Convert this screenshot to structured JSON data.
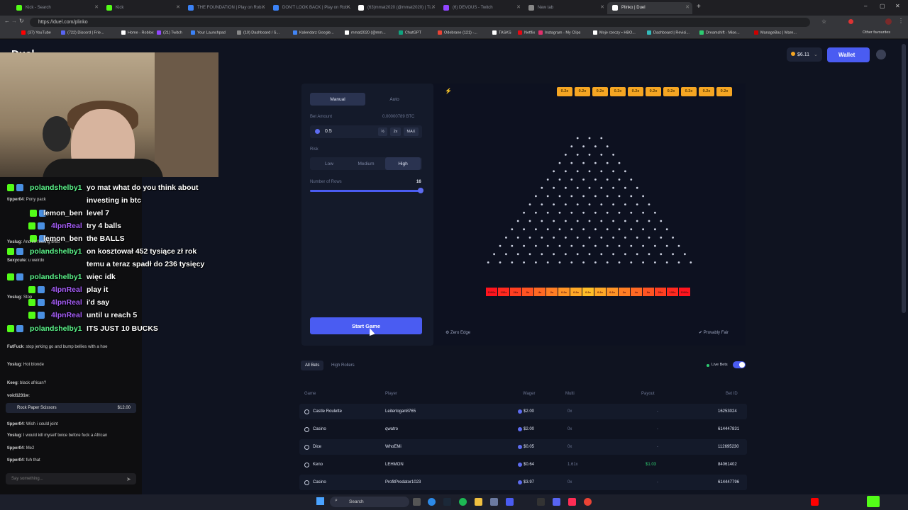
{
  "browser": {
    "tabs": [
      {
        "label": "Kick - Search",
        "color": "#53fc18"
      },
      {
        "label": "Kick",
        "color": "#53fc18"
      },
      {
        "label": "THE FOUNDATION | Play on Rob...",
        "color": "#3b82f6"
      },
      {
        "label": "DON'T LOOK BACK | Play on Rob...",
        "color": "#3b82f6"
      },
      {
        "label": "(63)mmat2020 (@mmat2020) | Ti...",
        "color": "#ffffff"
      },
      {
        "label": "(6) DEVOUS - Twitch",
        "color": "#9146ff"
      },
      {
        "label": "New tab",
        "color": "#888888"
      },
      {
        "label": "Plinko | Duel",
        "color": "#ffffff"
      }
    ],
    "url": "https://duel.com/plinko",
    "bookmarks": [
      "(37) YouTube",
      "(722) Discord | Frie...",
      "Home - Roblox",
      "(21) Twitch",
      "Your Launchpad",
      "(10) Dashboard / S...",
      "Kalendarz Google...",
      "mmat2020 (@mm...",
      "ChatGPT",
      "Odebrane (121) -...",
      "TASKS",
      "Netflix",
      "Instagram - My Clips",
      "Moje rzeczy • HBO...",
      "Dashboard | Revisi...",
      "Dreamshift - Mise...",
      "ManageBac | Mare..."
    ],
    "other_favourites": "Other favourites"
  },
  "header": {
    "logo": "Duel",
    "balance": "$6.11",
    "wallet": "Wallet"
  },
  "controls": {
    "mode_manual": "Manual",
    "mode_auto": "Auto",
    "bet_amount_label": "Bet Amount",
    "bet_btc": "0.00000789 BTC",
    "bet_value": "0.5",
    "half": "½",
    "double": "2x",
    "max": "MAX",
    "risk_label": "Risk",
    "risk_low": "Low",
    "risk_medium": "Medium",
    "risk_high": "High",
    "rows_label": "Number of Rows",
    "rows_value": "16",
    "rows_fraction": 1.0,
    "start": "Start Game"
  },
  "board": {
    "history": [
      "0.2x",
      "0.2x",
      "0.2x",
      "0.2x",
      "0.2x",
      "0.2x",
      "0.2x",
      "0.2x",
      "0.2x",
      "0.2x"
    ],
    "buckets": [
      "1000x",
      "130x",
      "26x",
      "9x",
      "4x",
      "2x",
      "0.2x",
      "0.2x",
      "0.2x",
      "0.2x",
      "0.2x",
      "2x",
      "4x",
      "9x",
      "26x",
      "130x",
      "1000x"
    ],
    "zero_edge": "Zero Edge",
    "provably_fair": "Provably Fair"
  },
  "bets": {
    "tab_all": "All Bets",
    "tab_high": "High Rollers",
    "live": "Live Bets",
    "headers": {
      "game": "Game",
      "player": "Player",
      "wager": "Wager",
      "multi": "Multi",
      "payout": "Payout",
      "betid": "Bet ID"
    },
    "rows": [
      {
        "game": "Castle Roulette",
        "player": "Leiterlogan8765",
        "wager": "$2.00",
        "multi": "0x",
        "payout": "-",
        "id": "16253024"
      },
      {
        "game": "Casino",
        "player": "qwatro",
        "wager": "$2.00",
        "multi": "0x",
        "payout": "-",
        "id": "614447831"
      },
      {
        "game": "Dice",
        "player": "WhoEMi",
        "wager": "$0.05",
        "multi": "0x",
        "payout": "-",
        "id": "112695230"
      },
      {
        "game": "Keno",
        "player": "LEHMON",
        "wager": "$0.64",
        "multi": "1.61x",
        "payout": "$1.03",
        "id": "84061402"
      },
      {
        "game": "Casino",
        "player": "ProfitPredator1023",
        "wager": "$3.97",
        "multi": "0x",
        "payout": "-",
        "id": "614447796"
      }
    ]
  },
  "stream_chat": {
    "big": [
      {
        "user": "",
        "msg": "yo mat what do you think about",
        "color": "#5cf58b"
      },
      {
        "user": "polandshelby1",
        "msg": "yo mat what do you think about",
        "color": "#5cf58b"
      },
      {
        "user": "",
        "msg": "investing in btc",
        "color": ""
      },
      {
        "user": "lemon_ben",
        "msg": "level 7",
        "color": "#ffffff"
      },
      {
        "user": "4lpnReal",
        "msg": "try 4 balls",
        "color": "#a45cf5"
      },
      {
        "user": "lemon_ben",
        "msg": "the BALLS",
        "color": "#ffffff"
      },
      {
        "user": "polandshelby1",
        "msg": "on kosztował 452 tysiące zł rok",
        "color": "#5cf58b"
      },
      {
        "user": "",
        "msg": "temu a teraz spadł do 236 tysięcy",
        "color": ""
      },
      {
        "user": "polandshelby1",
        "msg": "więc idk",
        "color": "#5cf58b"
      },
      {
        "user": "4lpnReal",
        "msg": "play it",
        "color": "#a45cf5"
      },
      {
        "user": "4lpnReal",
        "msg": "i'd say",
        "color": "#a45cf5"
      },
      {
        "user": "4lpnReal",
        "msg": "until u reach 5",
        "color": "#a45cf5"
      },
      {
        "user": "polandshelby1",
        "msg": "ITS JUST 10 BUCKS",
        "color": "#5cf58b"
      }
    ],
    "small": [
      {
        "user": "tipper04",
        "msg": "Pony pack"
      },
      {
        "user": "Yoslug",
        "msg": "And im feeling tired"
      },
      {
        "user": "Sexycute",
        "msg": "u weirdo"
      },
      {
        "user": "Yoslug",
        "msg": "Stop"
      },
      {
        "user": "FatFuck",
        "msg": "stop jerking go and bump bellies with a hoe"
      },
      {
        "user": "Yoslug",
        "msg": "Hot blonde"
      },
      {
        "user": "Keeg",
        "msg": "black african?"
      },
      {
        "user": "void1231w",
        "msg": ""
      },
      {
        "user": "tipper04",
        "msg": "Wish i could joint"
      },
      {
        "user": "Yoslug",
        "msg": "I would kill myself twice before fuck a African"
      },
      {
        "user": "tipper04",
        "msg": "Me2"
      },
      {
        "user": "tipper04",
        "msg": "fuh that"
      }
    ],
    "donation_name": "Rock Paper Scissors",
    "donation_amount": "$12.00",
    "input_placeholder": "Say something..."
  },
  "taskbar": {
    "search": "Search"
  }
}
